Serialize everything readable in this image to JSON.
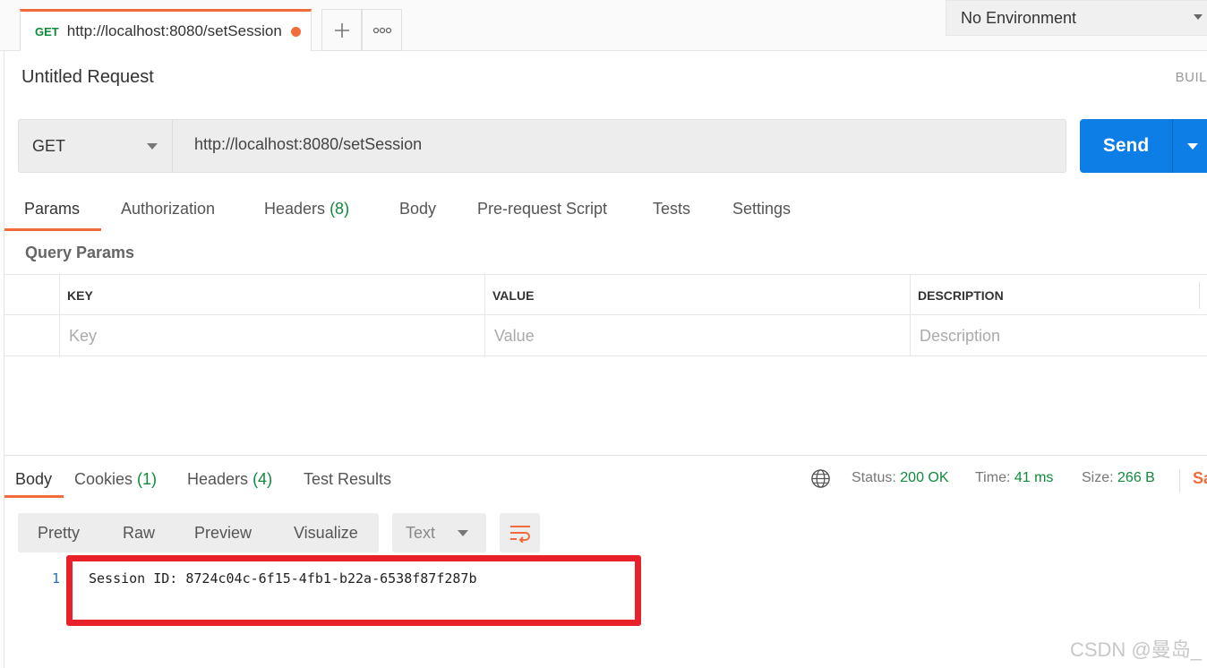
{
  "tab": {
    "method": "GET",
    "url": "http://localhost:8080/setSession",
    "add_icon": "plus-icon",
    "more_icon": "ellipsis-icon"
  },
  "environment": {
    "label": "No Environment"
  },
  "request": {
    "name": "Untitled Request",
    "build_label": "BUIL",
    "method": "GET",
    "url": "http://localhost:8080/setSession",
    "send_label": "Send"
  },
  "request_tabs": {
    "params": "Params",
    "authorization": "Authorization",
    "headers": "Headers",
    "headers_count": "(8)",
    "body": "Body",
    "prerequest": "Pre-request Script",
    "tests": "Tests",
    "settings": "Settings"
  },
  "query_params": {
    "title": "Query Params",
    "columns": {
      "key": "KEY",
      "value": "VALUE",
      "description": "DESCRIPTION"
    },
    "placeholders": {
      "key": "Key",
      "value": "Value",
      "description": "Description"
    }
  },
  "response_tabs": {
    "body": "Body",
    "cookies": "Cookies",
    "cookies_count": "(1)",
    "headers": "Headers",
    "headers_count": "(4)",
    "test_results": "Test Results",
    "save_label": "Sa"
  },
  "response_status": {
    "status_label": "Status:",
    "status_value": "200 OK",
    "time_label": "Time:",
    "time_value": "41 ms",
    "size_label": "Size:",
    "size_value": "266 B"
  },
  "response_view": {
    "pretty": "Pretty",
    "raw": "Raw",
    "preview": "Preview",
    "visualize": "Visualize",
    "format": "Text"
  },
  "response_body": {
    "line_number": "1",
    "line_text": "Session ID: 8724c04c-6f15-4fb1-b22a-6538f87f287b"
  },
  "watermark": "CSDN @曼岛_",
  "colors": {
    "accent_orange": "#f26b3a",
    "send_blue": "#0d7ee5",
    "status_green": "#0f8a3b",
    "highlight_red": "#e8202a"
  }
}
